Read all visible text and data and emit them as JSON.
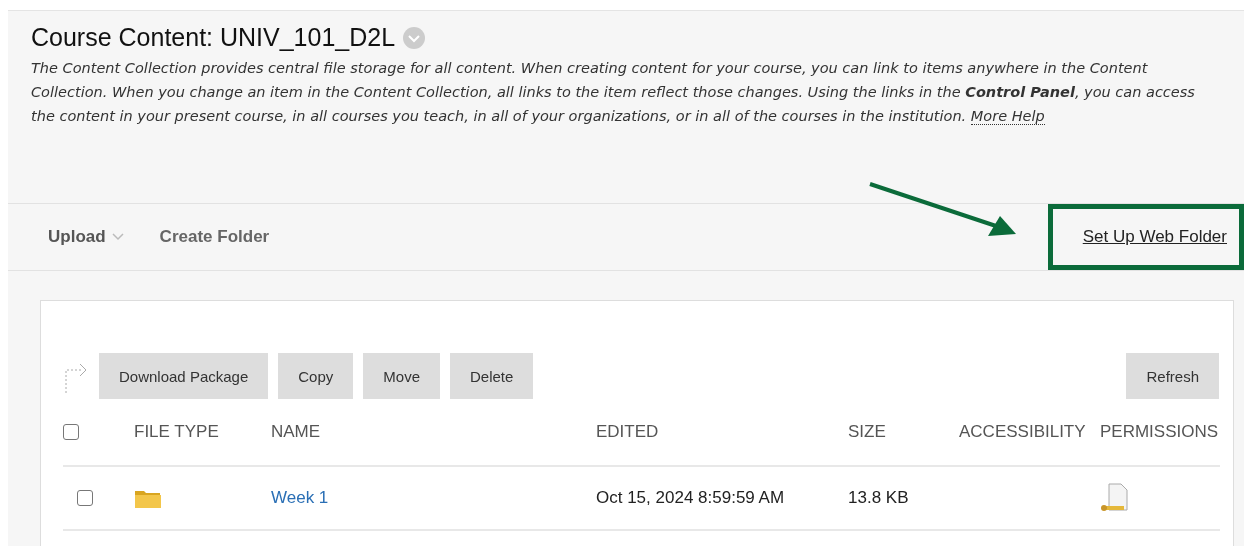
{
  "header": {
    "title": "Course Content: UNIV_101_D2L",
    "description": "The Content Collection provides central file storage for all content. When creating content for your course, you can link to items anywhere in the Content Collection. When you change an item in the Content Collection, all links to the item reflect those changes. Using the links in the **Control Panel**, you can access the content in your present course, in all courses you teach, in all of your organizations, or in all of the courses in the institution.",
    "help_link": "More Help"
  },
  "toolbar": [
    {
      "kind": "dropdown",
      "label": "Upload"
    },
    {
      "kind": "action",
      "label": "Create Folder"
    },
    {
      "kind": "link",
      "label": "Set Up Web Folder"
    }
  ],
  "actions": [
    "Download Package",
    "Copy",
    "Move",
    "Delete"
  ],
  "refresh": "Refresh",
  "table": {
    "select_all": {
      "checked": false
    },
    "columns": [
      "FILE TYPE",
      "NAME",
      "EDITED",
      "SIZE",
      "ACCESSIBILITY",
      "PERMISSIONS"
    ],
    "rows": [
      {
        "checked": false,
        "name": "Week 1",
        "edited": "Oct 15, 2024 8:59:59 AM",
        "size": "13.8 KB"
      }
    ]
  }
}
